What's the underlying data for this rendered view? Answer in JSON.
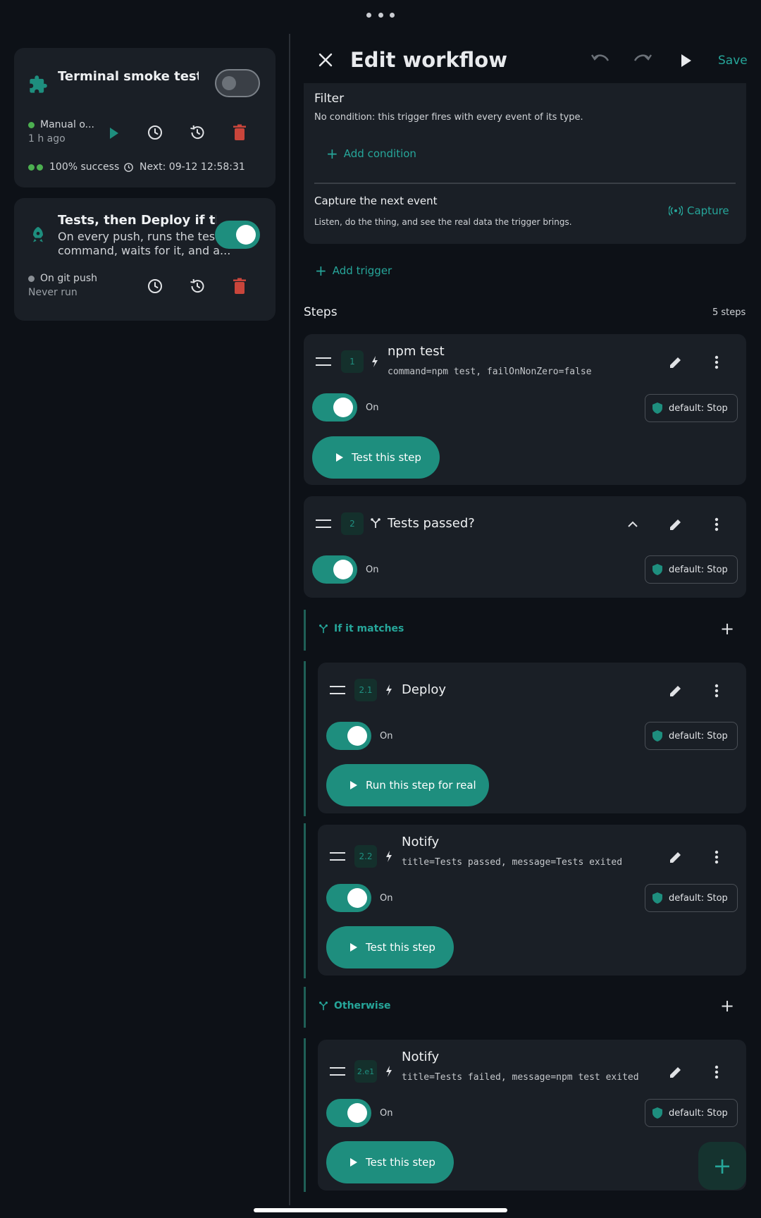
{
  "colors": {
    "accent": "#26a69a",
    "danger": "#c9453b",
    "success": "#4caf50",
    "background": "#0d1117",
    "card": "#1a1f26"
  },
  "workflows": [
    {
      "title": "Terminal smoke test",
      "icon": "puzzle-icon",
      "enabled": false,
      "trigger": "Manual o...",
      "last_run": "1 h ago",
      "success": "100% success",
      "next": "Next: 09-12 12:58:31"
    },
    {
      "title": "Tests, then Deploy if they ...",
      "icon": "rocket-icon",
      "enabled": true,
      "description_line1": "On every push, runs the test",
      "description_line2": "command, waits for it, and a...",
      "trigger": "On git push",
      "last_run": "Never run"
    }
  ],
  "editor": {
    "title": "Edit workflow",
    "save_label": "Save",
    "filter": {
      "heading": "Filter",
      "description": "No condition: this trigger fires with every event of its type.",
      "add_condition": "Add condition"
    },
    "capture": {
      "heading": "Capture the next event",
      "description": "Listen, do the thing, and see the real data the trigger brings.",
      "button": "Capture"
    },
    "add_trigger": "Add trigger",
    "steps_heading": "Steps",
    "steps_count": "5 steps",
    "on_label": "On",
    "policy_label": "default: Stop",
    "steps": [
      {
        "number": "1",
        "title": "npm test",
        "params": "command=npm test, failOnNonZero=false",
        "button": "Test this step"
      },
      {
        "number": "2",
        "title": "Tests passed?"
      },
      {
        "number": "2.1",
        "title": "Deploy",
        "button": "Run this step for real"
      },
      {
        "number": "2.2",
        "title": "Notify",
        "params": "title=Tests passed, message=Tests exited",
        "button": "Test this step"
      },
      {
        "number": "2.e1",
        "title": "Notify",
        "params": "title=Tests failed, message=npm test exited",
        "button": "Test this step"
      }
    ],
    "branches": {
      "match": "If it matches",
      "otherwise": "Otherwise"
    }
  }
}
